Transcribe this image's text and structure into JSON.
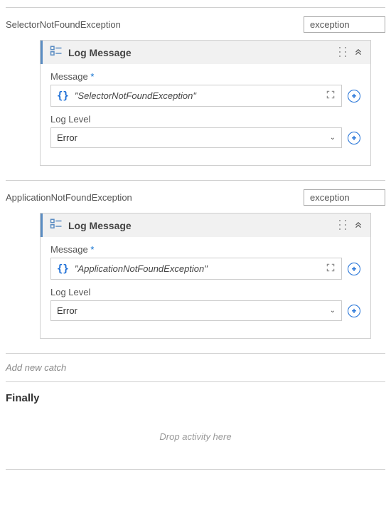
{
  "catches": [
    {
      "exceptionName": "SelectorNotFoundException",
      "typeLabel": "exception",
      "activity": {
        "title": "Log Message",
        "fields": {
          "messageLabel": "Message",
          "messageValue": "\"SelectorNotFoundException\"",
          "logLevelLabel": "Log Level",
          "logLevelValue": "Error"
        }
      }
    },
    {
      "exceptionName": "ApplicationNotFoundException",
      "typeLabel": "exception",
      "activity": {
        "title": "Log Message",
        "fields": {
          "messageLabel": "Message",
          "messageValue": "\"ApplicationNotFoundException\"",
          "logLevelLabel": "Log Level",
          "logLevelValue": "Error"
        }
      }
    }
  ],
  "addCatchLabel": "Add new catch",
  "finallyLabel": "Finally",
  "dropHint": "Drop activity here"
}
